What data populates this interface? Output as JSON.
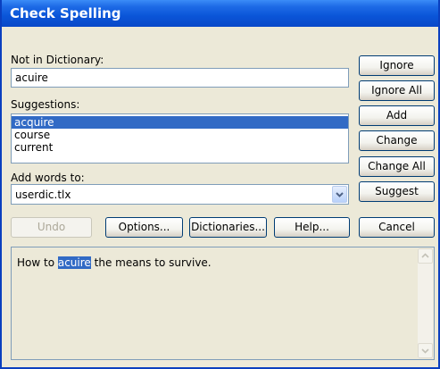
{
  "window": {
    "title": "Check Spelling"
  },
  "not_in_dictionary": {
    "label": "Not in Dictionary:",
    "value": "acuire"
  },
  "suggestions": {
    "label": "Suggestions:",
    "items": [
      "acquire",
      "course",
      "current"
    ],
    "selected": "acquire"
  },
  "add_words": {
    "label": "Add words to:",
    "value": "userdic.tlx"
  },
  "buttons": {
    "ignore": "Ignore",
    "ignore_all": "Ignore All",
    "add": "Add",
    "change": "Change",
    "change_all": "Change All",
    "suggest": "Suggest",
    "undo": "Undo",
    "options": "Options...",
    "dictionaries": "Dictionaries...",
    "help": "Help...",
    "cancel": "Cancel"
  },
  "context": {
    "before": "How to ",
    "word": "acuire",
    "after": " the means to survive."
  },
  "icons": {
    "combo_arrow": "chevron-down-icon",
    "scroll_up": "scroll-up-arrow-icon",
    "scroll_down": "scroll-down-arrow-icon"
  },
  "colors": {
    "titlebar": "#0a55d8",
    "dialog_bg": "#ece9d8",
    "selection": "#316ac5",
    "button_border": "#003c74"
  }
}
